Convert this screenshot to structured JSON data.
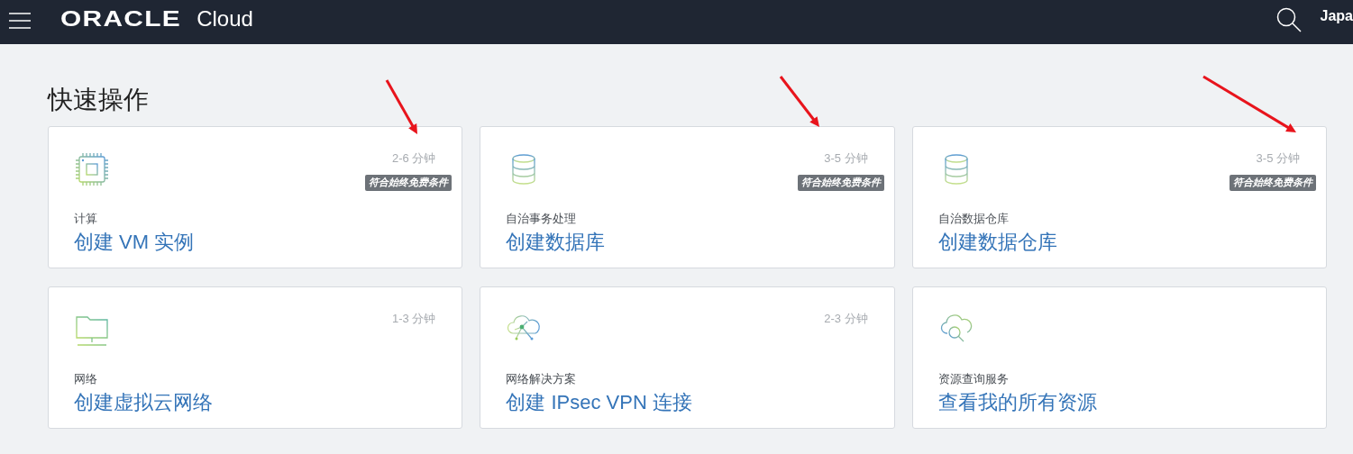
{
  "header": {
    "logo_brand": "ORACLE",
    "logo_product": "Cloud",
    "region": "Japa"
  },
  "section": {
    "title": "快速操作"
  },
  "cards": [
    {
      "kind": "chip",
      "duration": "2-6 分钟",
      "badge": "符合始终免费条件",
      "category": "计算",
      "title": "创建 VM 实例",
      "arrow": true
    },
    {
      "kind": "database",
      "duration": "3-5 分钟",
      "badge": "符合始终免费条件",
      "category": "自治事务处理",
      "title": "创建数据库",
      "arrow": true
    },
    {
      "kind": "database",
      "duration": "3-5 分钟",
      "badge": "符合始终免费条件",
      "category": "自治数据仓库",
      "title": "创建数据仓库",
      "arrow": true
    },
    {
      "kind": "folder-network",
      "duration": "1-3 分钟",
      "category": "网络",
      "title": "创建虚拟云网络",
      "arrow": false
    },
    {
      "kind": "cloud-network",
      "duration": "2-3 分钟",
      "category": "网络解决方案",
      "title": "创建 IPsec VPN 连接",
      "arrow": false
    },
    {
      "kind": "cloud-search",
      "category": "资源查询服务",
      "title": "查看我的所有资源",
      "arrow": false
    }
  ]
}
